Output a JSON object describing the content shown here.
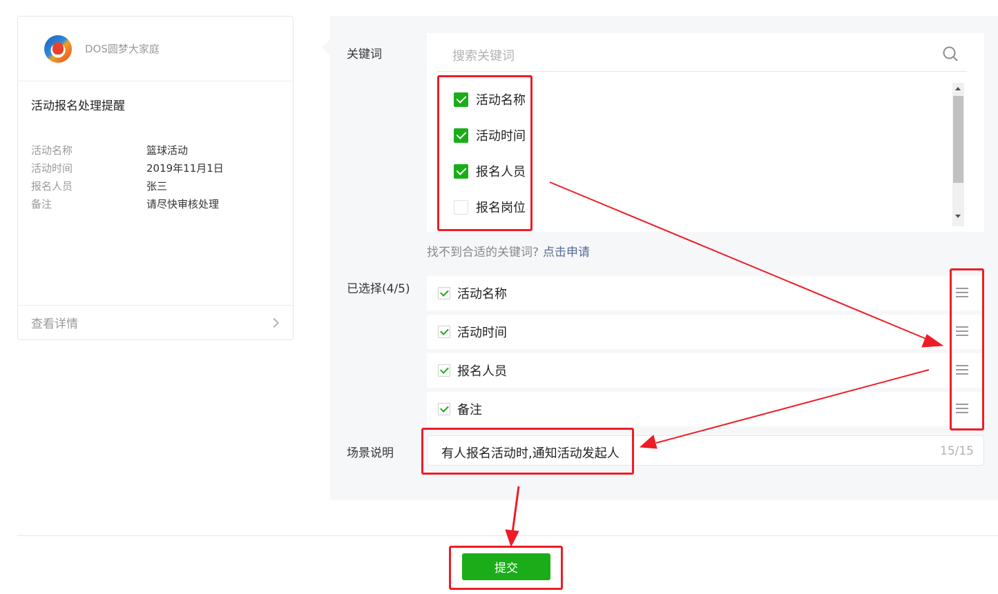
{
  "preview_card": {
    "org_name": "DOS圆梦大家庭",
    "title": "活动报名处理提醒",
    "fields": [
      {
        "label": "活动名称",
        "value": "篮球活动"
      },
      {
        "label": "活动时间",
        "value": "2019年11月1日"
      },
      {
        "label": "报名人员",
        "value": "张三"
      },
      {
        "label": "备注",
        "value": "请尽快审核处理"
      }
    ],
    "detail_link": "查看详情"
  },
  "keywords": {
    "label": "关键词",
    "search_placeholder": "搜索关键词",
    "options": [
      {
        "label": "活动名称",
        "checked": true
      },
      {
        "label": "活动时间",
        "checked": true
      },
      {
        "label": "报名人员",
        "checked": true
      },
      {
        "label": "报名岗位",
        "checked": false
      }
    ],
    "hint": "找不到合适的关键词?",
    "apply_link": "点击申请"
  },
  "selected": {
    "label": "已选择(4/5)",
    "items": [
      "活动名称",
      "活动时间",
      "报名人员",
      "备注"
    ]
  },
  "scene": {
    "label": "场景说明",
    "value": "有人报名活动时,通知活动发起人",
    "counter": "15/15"
  },
  "submit_label": "提交",
  "colors": {
    "accent": "#1aad19",
    "link": "#576b95",
    "annotation": "#ee1c25",
    "panel_bg": "#f6f7f9"
  }
}
